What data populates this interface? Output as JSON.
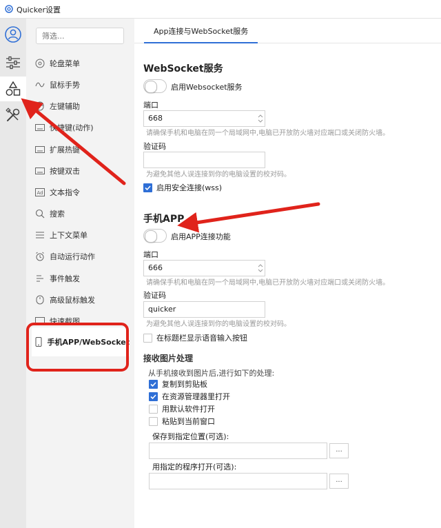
{
  "window": {
    "title": "Quicker设置"
  },
  "colors": {
    "accent": "#2f6fd6",
    "annotation_red": "#e0231b"
  },
  "sidebar": {
    "filter_placeholder": "筛选...",
    "items": [
      {
        "label": "轮盘菜单",
        "icon": "wheel-icon"
      },
      {
        "label": "鼠标手势",
        "icon": "gesture-icon"
      },
      {
        "label": "左键辅助",
        "icon": "mouse-left-icon"
      },
      {
        "label": "快捷键(动作)",
        "icon": "keyboard-icon"
      },
      {
        "label": "扩展热键",
        "icon": "keyboard-icon"
      },
      {
        "label": "按键双击",
        "icon": "keyboard-icon"
      },
      {
        "label": "文本指令",
        "icon": "text-command-icon"
      },
      {
        "label": "搜索",
        "icon": "search-icon"
      },
      {
        "label": "上下文菜单",
        "icon": "menu-lines-icon"
      },
      {
        "label": "自动运行动作",
        "icon": "alarm-clock-icon"
      },
      {
        "label": "事件触发",
        "icon": "event-trigger-icon"
      },
      {
        "label": "高级鼠标触发",
        "icon": "mouse-icon"
      },
      {
        "label": "快速截图",
        "icon": "screenshot-icon"
      },
      {
        "label": "手机APP/WebSocket",
        "icon": "phone-icon"
      }
    ]
  },
  "tabs": [
    {
      "label": "App连接与WebSocket服务"
    }
  ],
  "websocket": {
    "title": "WebSocket服务",
    "enable_label": "启用Websocket服务",
    "port_label": "端口",
    "port_value": "668",
    "port_hint": "请确保手机和电脑在同一个局域网中,电脑已开放防火墙对应端口或关闭防火墙。",
    "code_label": "验证码",
    "code_value": "",
    "code_hint": "为避免其他人误连接到你的电脑设置的校对码。",
    "secure_label": "启用安全连接(wss)"
  },
  "app": {
    "title": "手机APP",
    "enable_label": "启用APP连接功能",
    "port_label": "端口",
    "port_value": "666",
    "port_hint": "请确保手机和电脑在同一个局域网中,电脑已开放防火墙对应端口或关闭防火墙。",
    "code_label": "验证码",
    "code_value": "quicker",
    "code_hint": "为避免其他人误连接到你的电脑设置的校对码。",
    "voice_label": "在标题栏显示语音输入按钮"
  },
  "image": {
    "title": "接收图片处理",
    "desc": "从手机接收到图片后,进行如下的处理:",
    "options": [
      {
        "label": "复制到剪贴板",
        "checked": true
      },
      {
        "label": "在资源管理器里打开",
        "checked": true
      },
      {
        "label": "用默认软件打开",
        "checked": false
      },
      {
        "label": "粘贴到当前窗口",
        "checked": false
      }
    ],
    "save_label": "保存到指定位置(可选):",
    "save_value": "",
    "open_label": "用指定的程序打开(可选):",
    "open_value": "",
    "browse_label": "..."
  }
}
